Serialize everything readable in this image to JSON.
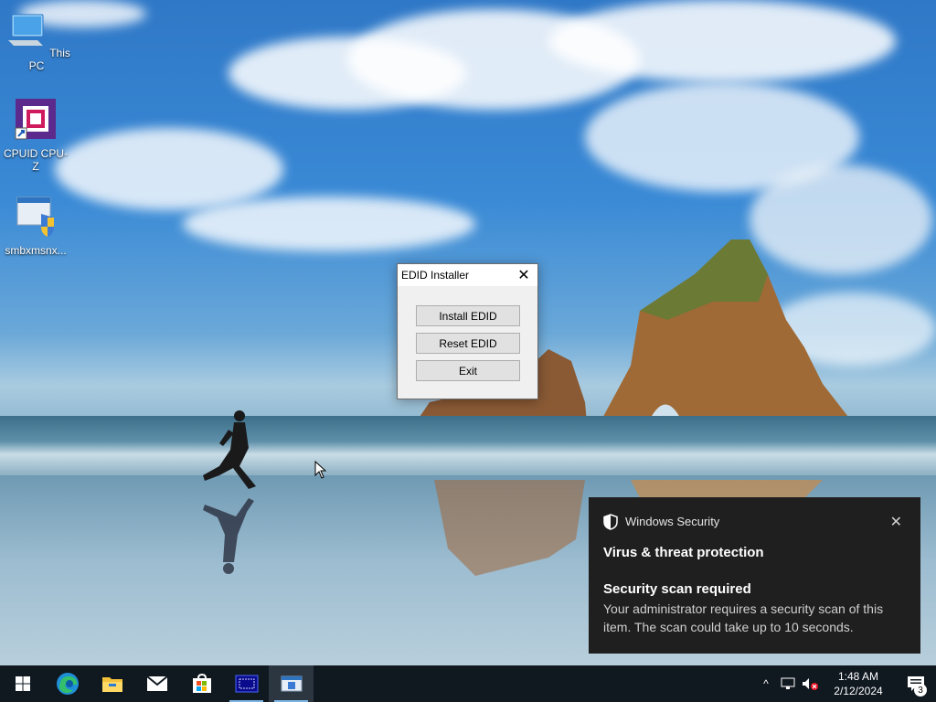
{
  "desktop": {
    "icons": [
      {
        "label": "This PC",
        "icon": "computer-icon"
      },
      {
        "label": "CPUID CPU-Z",
        "icon": "cpuz-icon"
      },
      {
        "label": "smbxmsnx...",
        "icon": "installer-shield-icon"
      }
    ]
  },
  "edid_window": {
    "title": "EDID Installer",
    "close_glyph": "✕",
    "buttons": [
      "Install EDID",
      "Reset EDID",
      "Exit"
    ]
  },
  "toast": {
    "app_name": "Windows Security",
    "close_glyph": "✕",
    "header": "Virus & threat protection",
    "title": "Security scan required",
    "body": "Your administrator requires a security scan of this item. The scan could take up to 10 seconds."
  },
  "taskbar": {
    "apps": [
      "start-button",
      "edge-icon",
      "file-explorer-icon",
      "mail-icon",
      "store-icon",
      "display-app-icon",
      "edid-installer-icon"
    ],
    "tray_chevron": "^",
    "time": "1:48 AM",
    "date": "2/12/2024",
    "notification_count": "3"
  },
  "colors": {
    "taskbar": "#101820",
    "toast_bg": "#1f1f1f",
    "window_bg": "#f0f0f0"
  }
}
